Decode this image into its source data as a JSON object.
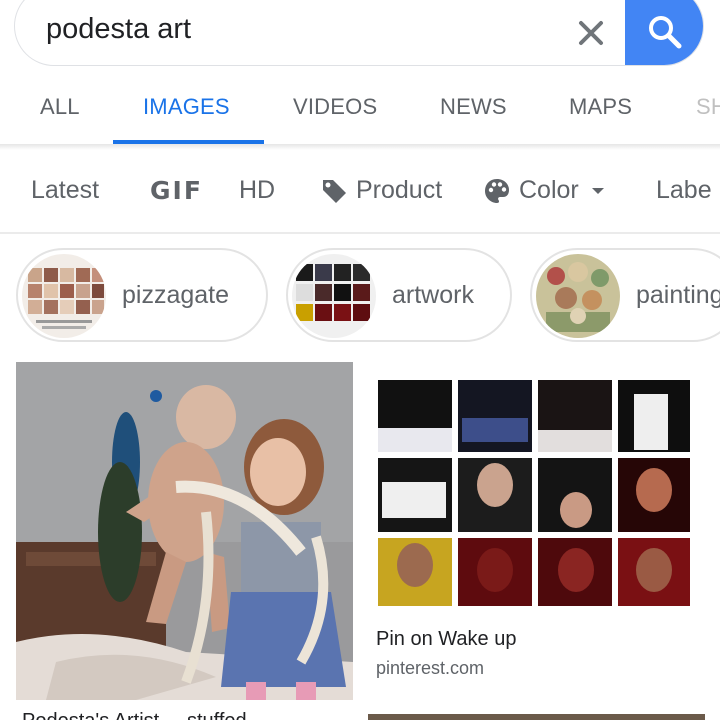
{
  "search": {
    "query": "podesta art"
  },
  "tabs": [
    {
      "label": "ALL",
      "active": false
    },
    {
      "label": "IMAGES",
      "active": true
    },
    {
      "label": "VIDEOS",
      "active": false
    },
    {
      "label": "NEWS",
      "active": false
    },
    {
      "label": "MAPS",
      "active": false
    },
    {
      "label": "SH",
      "active": false
    }
  ],
  "filters": {
    "latest": "Latest",
    "gif": "GIF",
    "hd": "HD",
    "product": "Product",
    "color": "Color",
    "labeled": "Labe"
  },
  "related": [
    {
      "label": "pizzagate"
    },
    {
      "label": "artwork"
    },
    {
      "label": "painting"
    }
  ],
  "results": {
    "left_caption": "Podesta's Artist ... stuffed ...",
    "right_title": "Pin on Wake up",
    "right_source": "pinterest.com"
  },
  "colors": {
    "accent": "#1a73e8",
    "search_button": "#4285f4",
    "muted_text": "#5f6368"
  }
}
